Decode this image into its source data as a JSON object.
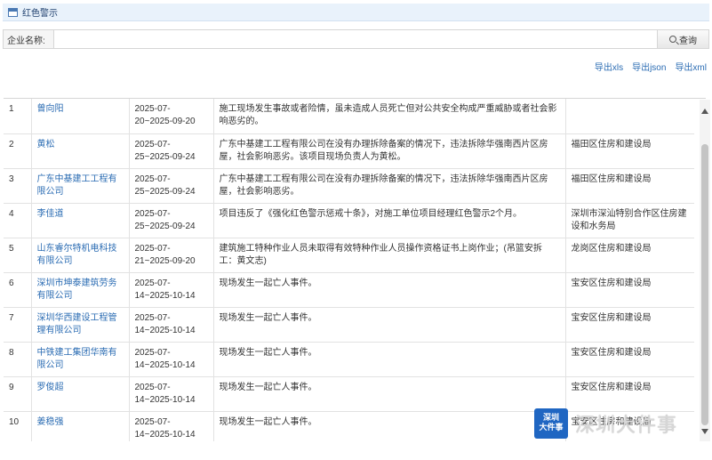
{
  "panel": {
    "title": "红色警示"
  },
  "search": {
    "label": "企业名称:",
    "value": "",
    "button_label": "查询"
  },
  "exports": [
    {
      "label": "导出xls"
    },
    {
      "label": "导出json"
    },
    {
      "label": "导出xml"
    }
  ],
  "rows": [
    {
      "no": "1",
      "name": "曾向阳",
      "date": "2025-07-20~2025-09-20",
      "desc": "施工现场发生事故或者险情，虽未造成人员死亡但对公共安全构成严重威胁或者社会影响恶劣的。",
      "dept": ""
    },
    {
      "no": "2",
      "name": "黄松",
      "date": "2025-07-25~2025-09-24",
      "desc": "广东中基建工工程有限公司在没有办理拆除备案的情况下，违法拆除华强南西片区房屋，社会影响恶劣。该项目现场负责人为黄松。",
      "dept": "福田区住房和建设局"
    },
    {
      "no": "3",
      "name": "广东中基建工工程有限公司",
      "date": "2025-07-25~2025-09-24",
      "desc": "广东中基建工工程有限公司在没有办理拆除备案的情况下，违法拆除华强南西片区房屋，社会影响恶劣。",
      "dept": "福田区住房和建设局"
    },
    {
      "no": "4",
      "name": "李佳道",
      "date": "2025-07-25~2025-09-24",
      "desc": "项目违反了《强化红色警示惩戒十条》，对施工单位项目经理红色警示2个月。",
      "dept": "深圳市深汕特别合作区住房建设和水务局"
    },
    {
      "no": "5",
      "name": "山东睿尔特机电科技有限公司",
      "date": "2025-07-21~2025-09-20",
      "desc": "建筑施工特种作业人员未取得有效特种作业人员操作资格证书上岗作业；(吊篮安拆工：黄文志)",
      "dept": "龙岗区住房和建设局"
    },
    {
      "no": "6",
      "name": "深圳市坤泰建筑劳务有限公司",
      "date": "2025-07-14~2025-10-14",
      "desc": "现场发生一起亡人事件。",
      "dept": "宝安区住房和建设局"
    },
    {
      "no": "7",
      "name": "深圳华西建设工程管理有限公司",
      "date": "2025-07-14~2025-10-14",
      "desc": "现场发生一起亡人事件。",
      "dept": "宝安区住房和建设局"
    },
    {
      "no": "8",
      "name": "中铁建工集团华南有限公司",
      "date": "2025-07-14~2025-10-14",
      "desc": "现场发生一起亡人事件。",
      "dept": "宝安区住房和建设局"
    },
    {
      "no": "9",
      "name": "罗俊超",
      "date": "2025-07-14~2025-10-14",
      "desc": "现场发生一起亡人事件。",
      "dept": "宝安区住房和建设局"
    },
    {
      "no": "10",
      "name": "姜稳强",
      "date": "2025-07-14~2025-10-14",
      "desc": "现场发生一起亡人事件。",
      "dept": "宝安区住房和建设局"
    }
  ],
  "watermark": {
    "badge_line1": "深圳",
    "badge_line2": "大件事",
    "text": "深圳大件事"
  }
}
